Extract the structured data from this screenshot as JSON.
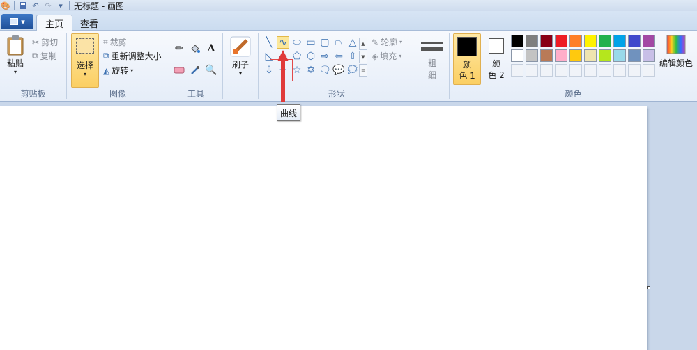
{
  "window": {
    "title": "无标题 - 画图"
  },
  "quick_access": {
    "icons": [
      "paint-app-icon",
      "save-icon",
      "undo-icon",
      "redo-icon",
      "customize-dropdown-icon"
    ]
  },
  "tabs": [
    {
      "label": "主页",
      "active": true
    },
    {
      "label": "查看",
      "active": false
    }
  ],
  "clipboard": {
    "group_label": "剪贴板",
    "paste_label": "粘贴",
    "cut_label": "剪切",
    "copy_label": "复制"
  },
  "image": {
    "group_label": "图像",
    "select_label": "选择",
    "crop_label": "裁剪",
    "resize_label": "重新调整大小",
    "rotate_label": "旋转"
  },
  "tools": {
    "group_label": "工具",
    "items": [
      "pencil-icon",
      "fill-bucket-icon",
      "text-icon",
      "eraser-icon",
      "color-picker-icon",
      "magnifier-icon"
    ]
  },
  "brushes": {
    "label": "刷子"
  },
  "shapes": {
    "group_label": "形状",
    "outline_label": "轮廓",
    "fill_label": "填充",
    "selected": "curve-shape",
    "items": [
      "line-shape",
      "curve-shape",
      "oval-shape",
      "rectangle-shape",
      "rounded-rectangle-shape",
      "polygon-shape",
      "triangle-shape",
      "right-triangle-shape",
      "diamond-shape",
      "pentagon-shape",
      "hexagon-shape",
      "right-arrow-shape",
      "left-arrow-shape",
      "up-arrow-shape",
      "down-arrow-shape",
      "four-point-star-shape",
      "five-point-star-shape",
      "six-point-star-shape",
      "rounded-callout-shape",
      "oval-callout-shape",
      "cloud-callout-shape"
    ]
  },
  "size": {
    "label_line1": "粗",
    "label_line2": "细"
  },
  "colors": {
    "group_label": "颜色",
    "color1_line1": "颜",
    "color1_line2": "色 1",
    "color2_line1": "颜",
    "color2_line2": "色 2",
    "color1_value": "#000000",
    "color2_value": "#ffffff",
    "edit_label": "编辑颜色",
    "palette_row1": [
      "#000000",
      "#7f7f7f",
      "#880015",
      "#ed1c24",
      "#ff7f27",
      "#fff200",
      "#22b14c",
      "#00a2e8",
      "#3f48cc",
      "#a349a4"
    ],
    "palette_row2": [
      "#ffffff",
      "#c3c3c3",
      "#b97a57",
      "#ffaec9",
      "#ffc90e",
      "#efe4b0",
      "#b5e61d",
      "#99d9ea",
      "#7092be",
      "#c8bfe7"
    ]
  },
  "tooltip": {
    "text": "曲线"
  },
  "annotation": {
    "highlight_color": "#e24a4a"
  }
}
